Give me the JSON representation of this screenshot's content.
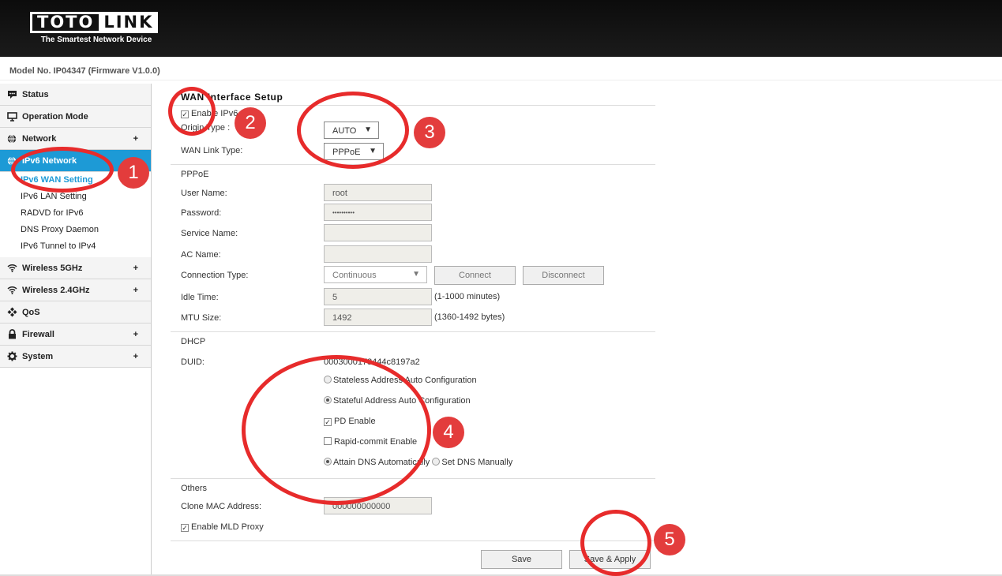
{
  "brand": {
    "logo_left": "TOTO",
    "logo_right": "LINK",
    "tagline": "The Smartest Network Device"
  },
  "model_text": "Model No. IP04347 (Firmware V1.0.0)",
  "sidebar": {
    "items": [
      {
        "label": "Status",
        "icon": "speech-bubble-icon"
      },
      {
        "label": "Operation Mode",
        "icon": "monitor-icon"
      },
      {
        "label": "Network",
        "icon": "globe-icon",
        "expand": "+"
      },
      {
        "label": "IPv6 Network",
        "icon": "globe-icon"
      },
      {
        "label": "Wireless 5GHz",
        "icon": "wifi-icon",
        "expand": "+"
      },
      {
        "label": "Wireless 2.4GHz",
        "icon": "wifi-icon",
        "expand": "+"
      },
      {
        "label": "QoS",
        "icon": "qos-icon"
      },
      {
        "label": "Firewall",
        "icon": "lock-icon",
        "expand": "+"
      },
      {
        "label": "System",
        "icon": "gear-icon",
        "expand": "+"
      }
    ],
    "sub_items": [
      "IPv6 WAN Setting",
      "IPv6 LAN Setting",
      "RADVD for IPv6",
      "DNS Proxy Daemon",
      "IPv6 Tunnel to IPv4"
    ]
  },
  "form": {
    "title": "WAN Interface Setup",
    "enable_ipv6": "Enable IPv6",
    "origin_type_label": "Origin Type :",
    "origin_type_value": "AUTO",
    "wan_link_label": "WAN Link Type:",
    "wan_link_value": "PPPoE",
    "pppoe_section": "PPPoE",
    "user_name_label": "User Name:",
    "user_name_value": "root",
    "password_label": "Password:",
    "password_value": "••••••••••",
    "service_name_label": "Service Name:",
    "ac_name_label": "AC Name:",
    "connection_type_label": "Connection Type:",
    "connection_type_value": "Continuous",
    "connect_button": "Connect",
    "disconnect_button": "Disconnect",
    "idle_time_label": "Idle Time:",
    "idle_time_value": "5",
    "idle_time_hint": "(1-1000 minutes)",
    "mtu_label": "MTU Size:",
    "mtu_value": "1492",
    "mtu_hint": "(1360-1492 bytes)",
    "dhcp_section": "DHCP",
    "duid_label": "DUID:",
    "duid_value": "0003000178444c8197a2",
    "stateless": "Stateless Address Auto Configuration",
    "stateful": "Stateful Address Auto Configuration",
    "pd_enable": "PD Enable",
    "rapid_commit": "Rapid-commit Enable",
    "attain_dns": "Attain DNS Automatically",
    "set_dns": "Set DNS Manually",
    "others_section": "Others",
    "clone_mac_label": "Clone MAC Address:",
    "clone_mac_value": "000000000000",
    "mld_proxy": "Enable MLD Proxy",
    "save_button": "Save",
    "save_apply_button": "Save & Apply"
  },
  "annotations": [
    "1",
    "2",
    "3",
    "4",
    "5"
  ],
  "colors": {
    "accent": "#1d9ad6",
    "annotation": "#e33c3c"
  }
}
